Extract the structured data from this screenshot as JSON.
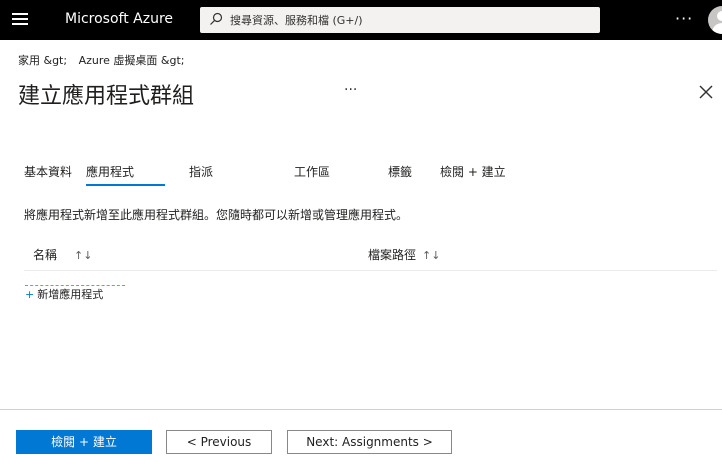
{
  "header": {
    "brand": "Microsoft Azure",
    "search_placeholder": "搜尋資源、服務和檔 (G+/)",
    "more_label": "···"
  },
  "breadcrumb": [
    "家用 &gt;",
    "Azure 虛擬桌面 &gt;"
  ],
  "page": {
    "title": "建立應用程式群組",
    "title_more": "···"
  },
  "tabs": [
    {
      "label": "基本資料",
      "selected": false
    },
    {
      "label": "應用程式",
      "selected": true
    },
    {
      "label": "指派",
      "selected": false
    },
    {
      "label": "工作區",
      "selected": false
    },
    {
      "label": "標籤",
      "selected": false
    },
    {
      "label": "檢閱 + 建立",
      "selected": false
    }
  ],
  "content": {
    "description": "將應用程式新增至此應用程式群組。您隨時都可以新增或管理應用程式。",
    "columns": [
      {
        "label": "名稱",
        "sort_icon": "↑↓"
      },
      {
        "label": "檔案路徑",
        "sort_icon": "↑↓"
      }
    ],
    "add_app": {
      "plus": "+",
      "label": "新增應用程式"
    }
  },
  "footer": {
    "review_create": "檢閱 + 建立",
    "previous": "< Previous",
    "next": "Next: Assignments >"
  },
  "colors": {
    "topbar": "#000000",
    "accent": "#0078d4"
  }
}
